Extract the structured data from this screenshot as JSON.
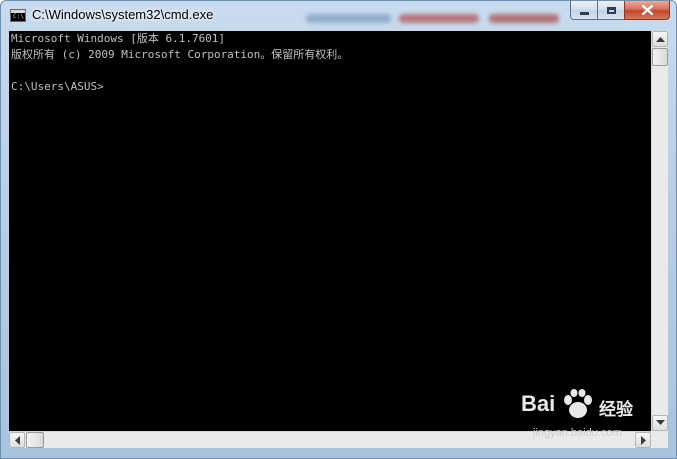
{
  "window": {
    "title": "C:\\Windows\\system32\\cmd.exe",
    "icon": "cmd-icon",
    "icon_text": "C:\\",
    "buttons": {
      "minimize": "minimize-icon",
      "maximize": "maximize-icon",
      "close": "close-icon"
    }
  },
  "console": {
    "background": "#000000",
    "foreground": "#c0c0c0",
    "lines": [
      "Microsoft Windows [版本 6.1.7601]",
      "版权所有 (c) 2009 Microsoft Corporation。保留所有权利。",
      "",
      "C:\\Users\\ASUS>"
    ]
  },
  "scrollbars": {
    "vertical": {
      "position": 0
    },
    "horizontal": {
      "position": 0
    }
  },
  "watermark": {
    "brand": "Bai",
    "brand_suffix": "经验",
    "url": "jingyan.baidu.com"
  },
  "colors": {
    "titlebar": "#b9cfe6",
    "close_button": "#c2452a"
  }
}
